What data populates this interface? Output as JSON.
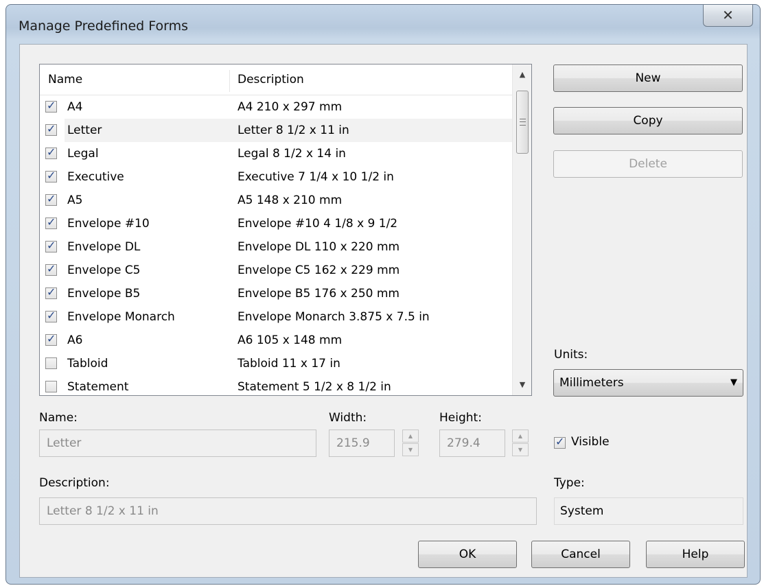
{
  "window": {
    "title": "Manage Predefined Forms",
    "close_glyph": "✕"
  },
  "list": {
    "columns": [
      "Name",
      "Description"
    ],
    "rows": [
      {
        "name": "A4",
        "description": "A4 210 x 297 mm",
        "checked": true
      },
      {
        "name": "Letter",
        "description": "Letter 8 1/2 x 11 in",
        "checked": true,
        "selected": true
      },
      {
        "name": "Legal",
        "description": "Legal 8 1/2 x 14 in",
        "checked": true
      },
      {
        "name": "Executive",
        "description": "Executive 7 1/4 x 10 1/2 in",
        "checked": true
      },
      {
        "name": "A5",
        "description": "A5 148 x 210 mm",
        "checked": true
      },
      {
        "name": "Envelope #10",
        "description": "Envelope #10 4 1/8 x 9 1/2",
        "checked": true
      },
      {
        "name": "Envelope DL",
        "description": "Envelope DL 110 x 220 mm",
        "checked": true
      },
      {
        "name": "Envelope C5",
        "description": "Envelope C5 162 x 229 mm",
        "checked": true
      },
      {
        "name": "Envelope B5",
        "description": "Envelope B5  176 x 250 mm",
        "checked": true
      },
      {
        "name": "Envelope Monarch",
        "description": "Envelope Monarch 3.875 x 7.5 in",
        "checked": true
      },
      {
        "name": "A6",
        "description": "A6 105 x 148 mm",
        "checked": true
      },
      {
        "name": "Tabloid",
        "description": "Tabloid 11 x 17 in",
        "checked": false
      },
      {
        "name": "Statement",
        "description": "Statement 5 1/2 x 8 1/2 in",
        "checked": false
      }
    ]
  },
  "buttons": {
    "new": "New",
    "copy": "Copy",
    "delete": "Delete",
    "ok": "OK",
    "cancel": "Cancel",
    "help": "Help"
  },
  "units": {
    "label": "Units:",
    "value": "Millimeters"
  },
  "form": {
    "name_label": "Name:",
    "name_value": "Letter",
    "width_label": "Width:",
    "width_value": "215.9",
    "height_label": "Height:",
    "height_value": "279.4",
    "visible_label": "Visible",
    "description_label": "Description:",
    "description_value": "Letter 8 1/2 x 11 in",
    "type_label": "Type:",
    "type_value": "System"
  }
}
